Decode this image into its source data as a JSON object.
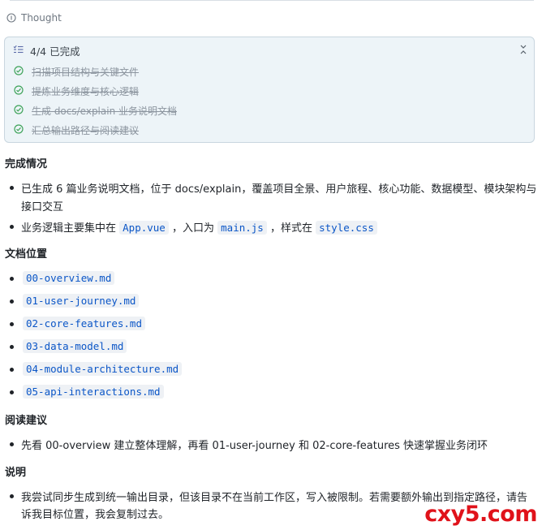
{
  "thought": {
    "label": "Thought"
  },
  "todo": {
    "header": "4/4 已完成",
    "items": [
      {
        "label": "扫描项目结构与关键文件",
        "done": true
      },
      {
        "label": "提炼业务维度与核心逻辑",
        "done": true
      },
      {
        "label": "生成 docs/explain 业务说明文档",
        "done": true
      },
      {
        "label": "汇总输出路径与阅读建议",
        "done": true
      }
    ]
  },
  "sections": {
    "completion": {
      "heading": "完成情况",
      "b1_line1": "已生成 6 篇业务说明文档，位于 docs/explain，覆盖项目全景、用户旅程、核心功能、数据模型、模块架构与",
      "b1_line2": "接口交互",
      "b2_pre": "业务逻辑主要集中在",
      "b2_code1": "App.vue",
      "b2_mid": "，入口为",
      "b2_code2": "main.js",
      "b2_mid2": "，样式在",
      "b2_code3": "style.css"
    },
    "docs": {
      "heading": "文档位置",
      "files": [
        "00-overview.md",
        "01-user-journey.md",
        "02-core-features.md",
        "03-data-model.md",
        "04-module-architecture.md",
        "05-api-interactions.md"
      ]
    },
    "reading": {
      "heading": "阅读建议",
      "text": "先看 00-overview 建立整体理解，再看 01-user-journey 和 02-core-features 快速掌握业务闭环"
    },
    "notes": {
      "heading": "说明",
      "line1": "我尝试同步生成到统一输出目录，但该目录不在当前工作区，写入被限制。若需要额外输出到指定路径，请告",
      "line2": "诉我目标位置，我会复制过去。"
    }
  },
  "watermark": "cxy5.com",
  "colors": {
    "accent": "#0b56c7",
    "check": "#3fa35a",
    "panel_bg": "#edf4f8"
  }
}
